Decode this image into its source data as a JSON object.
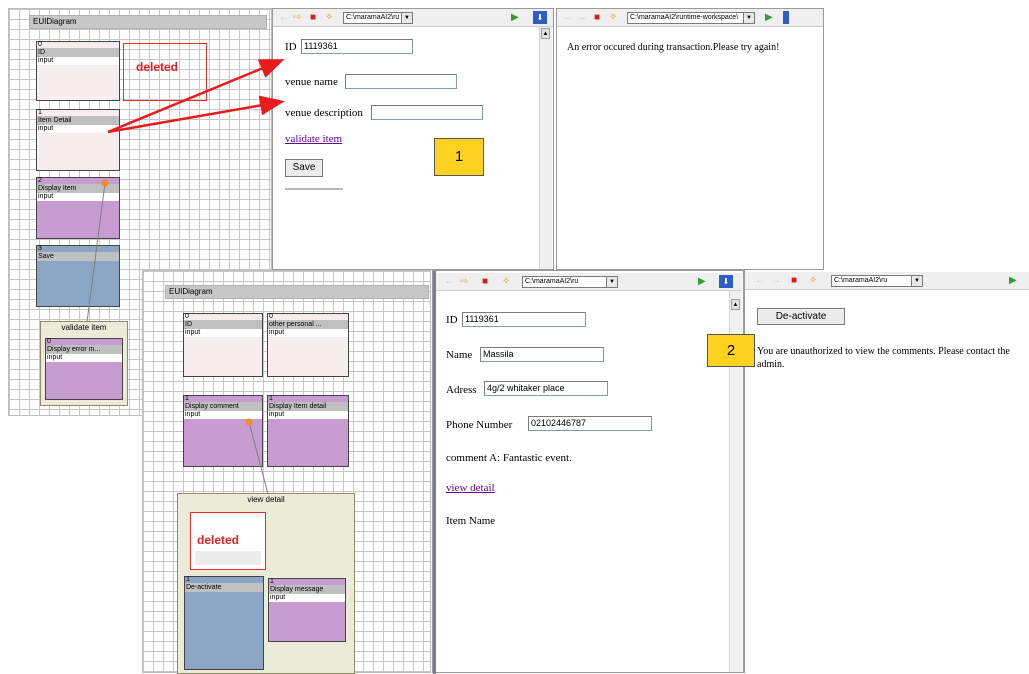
{
  "diagram1": {
    "title": "EUIDiagram",
    "widgets": [
      {
        "id": "0",
        "name": "ID",
        "type": "input"
      },
      {
        "id": "1",
        "name": "Item Detail",
        "type": "input"
      },
      {
        "id": "2",
        "name": "Display Item",
        "type": "input"
      },
      {
        "id": "3",
        "name": "Save",
        "type": ""
      }
    ],
    "deleted_label": "deleted",
    "container": {
      "title": "validate item",
      "widget": {
        "id": "0",
        "name": "Display error m...",
        "type": "input"
      }
    }
  },
  "browser1a": {
    "url": "C:\\maramaAI2\\ru",
    "fields": [
      {
        "label": "ID",
        "value": "1119361"
      },
      {
        "label": "venue name",
        "value": ""
      },
      {
        "label": "venue description",
        "value": ""
      }
    ],
    "link": "validate item",
    "save_button": "Save"
  },
  "browser1b": {
    "url": "C:\\maramaAI2\\runtime-workspace\\",
    "message": "An error occured during transaction.Please try again!"
  },
  "badge1": "1",
  "diagram2": {
    "title": "EUIDiagram",
    "widgets": [
      {
        "id": "0",
        "name": "ID",
        "type": "input"
      },
      {
        "id": "0",
        "name": "other personal ...",
        "type": "input"
      },
      {
        "id": "1",
        "name": "Display comment",
        "type": "input"
      },
      {
        "id": "1",
        "name": "Display Item detail",
        "type": "input"
      }
    ],
    "container": {
      "title": "view detail",
      "deleted_label": "deleted",
      "widgets": [
        {
          "id": "1",
          "name": "De-activate",
          "type": ""
        },
        {
          "id": "1",
          "name": "Display message",
          "type": "input"
        }
      ]
    }
  },
  "browser2a": {
    "url": "C:\\maramaAI2\\ru",
    "fields": [
      {
        "label": "ID",
        "value": "1119361"
      },
      {
        "label": "Name",
        "value": "Massila"
      },
      {
        "label": "Adress",
        "value": "4g/2 whitaker place"
      },
      {
        "label": "Phone Number",
        "value": "02102446787"
      }
    ],
    "comment": "comment A: Fantastic event.",
    "link": "view detail",
    "item_name": "Item Name"
  },
  "browser2b": {
    "url": "C:\\maramaAI2\\ru",
    "button": "De-activate",
    "message": "You are unauthorized to view the comments. Please contact the admin."
  },
  "badge2": "2",
  "colors": {
    "arrow": "#e81c1c",
    "badge": "#ffd21f",
    "deleted": "#e02020",
    "connector": "#f08c28"
  }
}
